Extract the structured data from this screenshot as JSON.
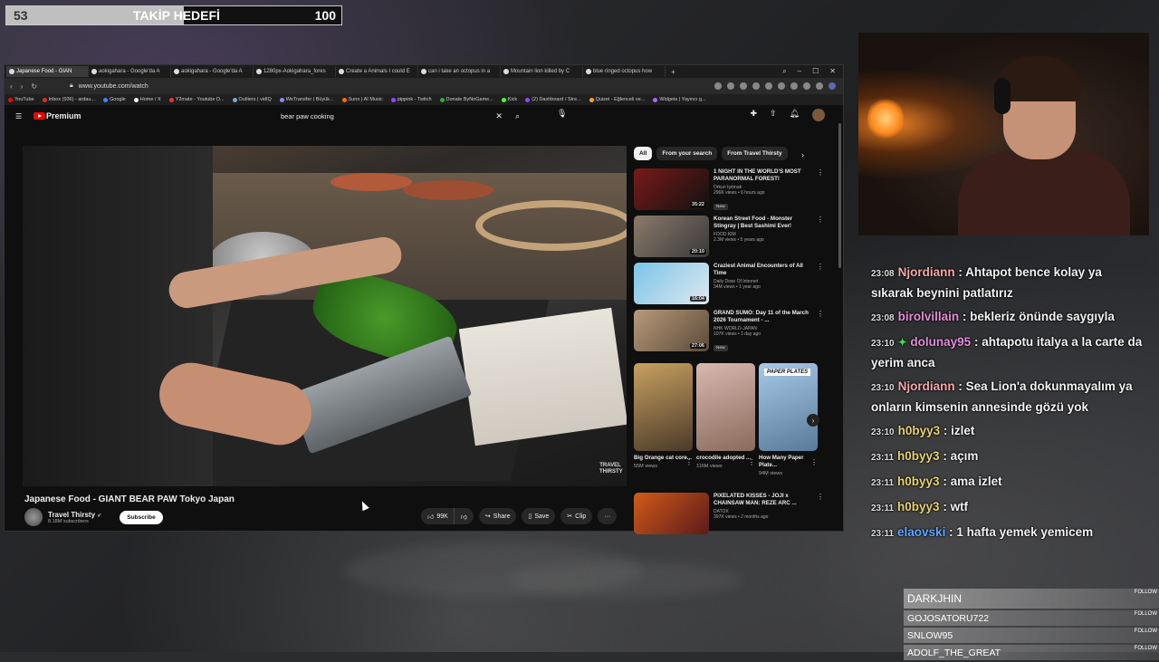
{
  "goal": {
    "current": "53",
    "label": "TAKİP HEDEFİ",
    "target": "100",
    "progress": 0.53
  },
  "browser": {
    "tabs": [
      {
        "label": "Japanese Food - GIAN",
        "active": true
      },
      {
        "label": "aokigahara - Google'da A"
      },
      {
        "label": "aokigahara - Google'da A"
      },
      {
        "label": "1280px-Aokigahara_fores"
      },
      {
        "label": "Create a Animals I could E"
      },
      {
        "label": "can i take an octopus in a"
      },
      {
        "label": "Mountain lion killed by C"
      },
      {
        "label": "blue ringed octopus how"
      }
    ],
    "new_tab": "+",
    "url": "www.youtube.com/watch",
    "bookmarks": [
      "YouTube",
      "Inbox (936) - ardau...",
      "Google",
      "Home / X",
      "Y2mate - Youtube D...",
      "Outliers | vidIQ",
      "WeTransfer | Büyük...",
      "Suno | AI Music",
      "pippink - Twitch",
      "Donate ByNoGame...",
      "Kick",
      "(2) Dashboard / Stre...",
      "Quizei - Eğlenceli ve...",
      "Widgets | Yayıncı g..."
    ]
  },
  "youtube": {
    "logo": "Premium",
    "search_value": "bear paw cooking",
    "video_watermark": "TRAVEL THIRSTY",
    "video_title": "Japanese Food - GIANT BEAR PAW Tokyo Japan",
    "channel_name": "Travel Thirsty",
    "channel_subs": "8.18M subscribers",
    "subscribe": "Subscribe",
    "likes": "99K",
    "share": "Share",
    "save": "Save",
    "clip": "Clip",
    "chips": [
      "All",
      "From your search",
      "From Travel Thirsty"
    ],
    "recommended": [
      {
        "title": "1 NIGHT IN THE WORLD'S MOST PARANORMAL FOREST!",
        "channel": "Orkun Işıtmak",
        "meta": "296K views • 6 hours ago",
        "duration": "35:22",
        "badge": "New",
        "colors": [
          "#7a1a1a",
          "#111"
        ]
      },
      {
        "title": "Korean Street Food - Monster Stingray | Best Sashimi Ever!",
        "channel": "FOOD KIM",
        "meta": "2.3M views • 5 years ago",
        "duration": "20:10",
        "badge": "",
        "colors": [
          "#8a7a6a",
          "#3a3a3a"
        ]
      },
      {
        "title": "Craziest Animal Encounters of All Time",
        "channel": "Daily Dose Of Internet",
        "meta": "34M views • 1 year ago",
        "duration": "16:04",
        "badge": "",
        "colors": [
          "#7ac4e8",
          "#dfe8ee"
        ]
      },
      {
        "title": "GRAND SUMO: Day 11 of the March 2026 Tournament - ...",
        "channel": "NHK WORLD-JAPAN",
        "meta": "107K views • 1 day ago",
        "duration": "27:06",
        "badge": "New",
        "colors": [
          "#b89a7a",
          "#5a4a3a"
        ]
      },
      {
        "title": "PIXELATED KISSES - JOJI x CHAINSAW MAN: REZE ARC ...",
        "channel": "DATOX",
        "meta": "397K views • 2 months ago",
        "duration": "",
        "badge": "",
        "colors": [
          "#d25a1a",
          "#5a1a1a"
        ]
      }
    ],
    "shorts": [
      {
        "title": "Big Orange cat core...",
        "views": "55M views",
        "colors": [
          "#c8a060",
          "#4a3a2a"
        ]
      },
      {
        "title": "crocodile adopted ...",
        "views": "116M views",
        "colors": [
          "#d8b8b0",
          "#8a6a5a"
        ]
      },
      {
        "title": "How Many Paper Plate...",
        "views": "94M views",
        "overlay": "PAPER PLATES",
        "colors": [
          "#a8c8e8",
          "#5a7a9a"
        ]
      }
    ]
  },
  "chat": [
    {
      "time": "23:08",
      "user": "Njordiann",
      "color": "#f4a7a7",
      "text": "Ahtapot bence kolay ya sıkarak beynini patlatırız"
    },
    {
      "time": "23:08",
      "user": "birolvillain",
      "color": "#e58cd9",
      "text": "bekleriz önünde saygıyla"
    },
    {
      "time": "23:10",
      "user": "dolunay95",
      "color": "#e58cd9",
      "badge": "✦",
      "text": "ahtapotu italya a la carte da yerim anca"
    },
    {
      "time": "23:10",
      "user": "Njordiann",
      "color": "#f4a7a7",
      "text": "Sea Lion'a dokunmayalım ya onların kimsenin annesinde gözü yok"
    },
    {
      "time": "23:10",
      "user": "h0byy3",
      "color": "#e8d36a",
      "text": "izlet"
    },
    {
      "time": "23:11",
      "user": "h0byy3",
      "color": "#e8d36a",
      "text": "açım"
    },
    {
      "time": "23:11",
      "user": "h0byy3",
      "color": "#e8d36a",
      "text": "ama izlet"
    },
    {
      "time": "23:11",
      "user": "h0byy3",
      "color": "#e8d36a",
      "text": "wtf"
    },
    {
      "time": "23:11",
      "user": "elaovski",
      "color": "#5fa8ff",
      "text": "1 hafta yemek yemicem"
    }
  ],
  "follows": {
    "label": "FOLLOW",
    "names": [
      "DARKJHIN",
      "GOJOSATORU722",
      "SNLOW95",
      "ADOLF_THE_GREAT"
    ]
  }
}
